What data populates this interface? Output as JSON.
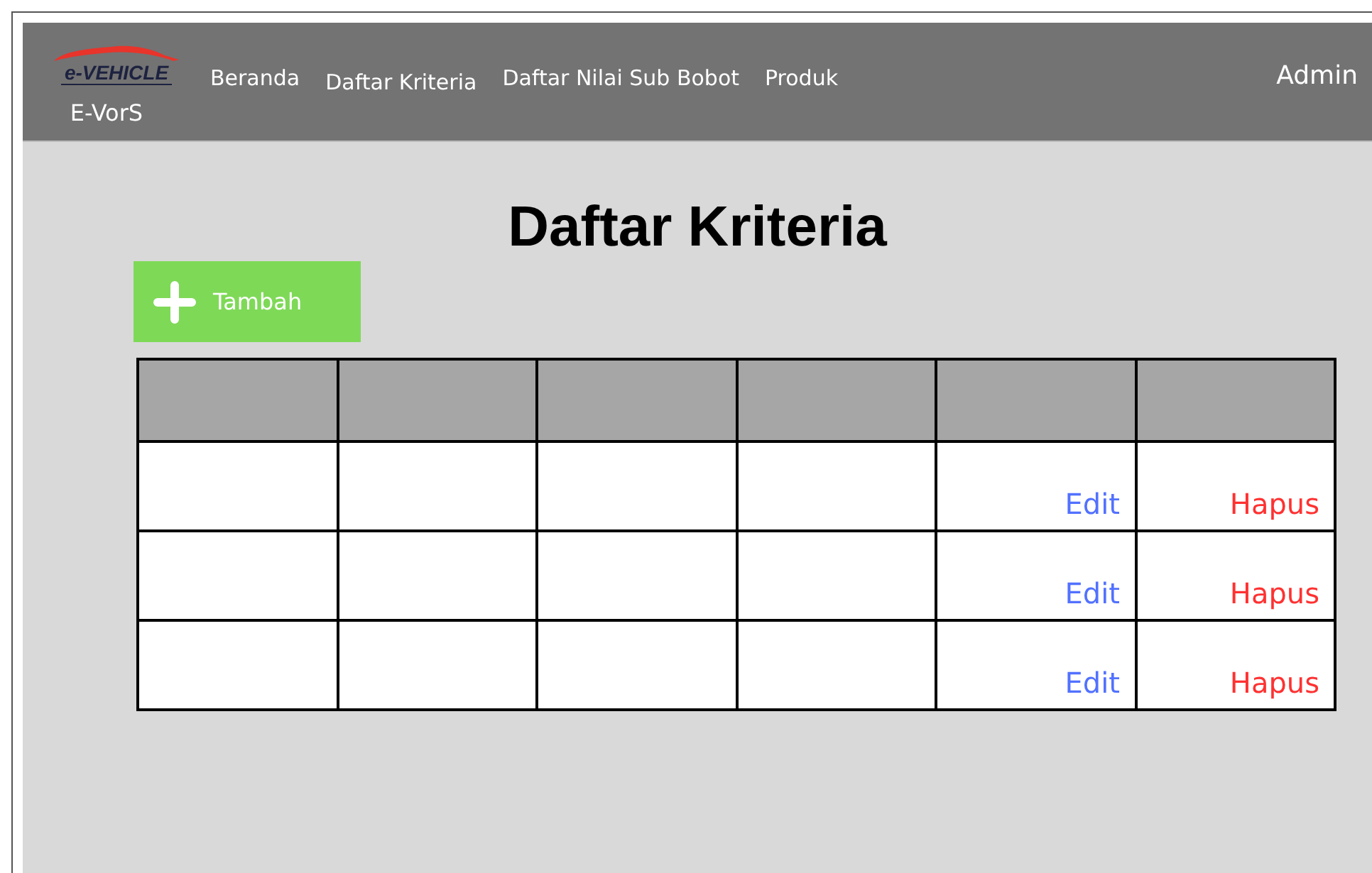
{
  "navbar": {
    "logo_text": "e-VEHICLE",
    "brand": "E-VorS",
    "links": [
      "Beranda",
      "Daftar Kriteria",
      "Daftar Nilai Sub Bobot",
      "Produk"
    ],
    "user": "Admin"
  },
  "page_title": "Daftar Kriteria",
  "add_button": {
    "label": "Tambah"
  },
  "table": {
    "rows": [
      {
        "edit": "Edit",
        "delete": "Hapus"
      },
      {
        "edit": "Edit",
        "delete": "Hapus"
      },
      {
        "edit": "Edit",
        "delete": "Hapus"
      }
    ]
  }
}
